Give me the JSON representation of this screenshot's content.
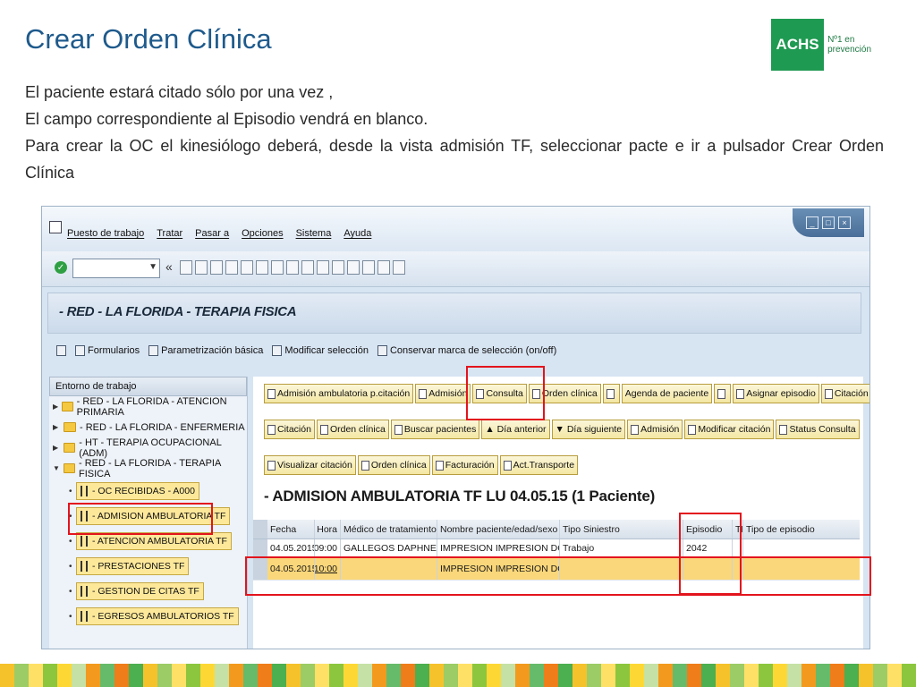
{
  "slide": {
    "title": "Crear Orden Clínica",
    "logo_text": "ACHS",
    "logo_tagline_1": "Nº1 en",
    "logo_tagline_2": "prevención",
    "para1": "El  paciente estará  citado sólo por una vez ,",
    "para2": "El campo correspondiente al  Episodio vendrá en blanco.",
    "para3": "Para crear la OC el kinesiólogo deberá, desde la vista admisión TF, seleccionar pacte e ir a pulsador Crear Orden Clínica"
  },
  "sap": {
    "menu": [
      "Puesto de trabajo",
      "Tratar",
      "Pasar a",
      "Opciones",
      "Sistema",
      "Ayuda"
    ],
    "toolbar": {
      "back_symbol": "«"
    },
    "title": "- RED - LA FLORIDA - TERAPIA FISICA",
    "app_toolbar": [
      "Formularios",
      "Parametrización básica",
      "Modificar selección",
      "Conservar marca de selección (on/off)"
    ],
    "left_panel": {
      "header": "Entorno de trabajo",
      "folders": [
        "- RED - LA FLORIDA - ATENCION PRIMARIA",
        "- RED - LA FLORIDA - ENFERMERIA",
        "- HT - TERAPIA OCUPACIONAL (ADM)",
        "- RED - LA FLORIDA - TERAPIA FISICA"
      ],
      "leaves": [
        "- OC RECIBIDAS - A000",
        "- ADMISION AMBULATORIA TF",
        "- ATENCION AMBULATORIA TF",
        "- PRESTACIONES TF",
        "- GESTION DE CITAS TF",
        "- EGRESOS AMBULATORIOS TF"
      ]
    },
    "buttons_row1": [
      "Admisión ambulatoria p.citación",
      "Admisión",
      "Consulta",
      "Orden clínica",
      "",
      "Agenda de paciente",
      "",
      "Asignar episodio",
      "Citación"
    ],
    "buttons_row2": [
      "Citación",
      "Orden clínica",
      "Buscar pacientes",
      "Día anterior",
      "Día siguiente",
      "Admisión",
      "Modificar citación",
      "Status Consulta"
    ],
    "buttons_row3": [
      "Visualizar citación",
      "Orden clínica",
      "Facturación",
      "Act.Transporte"
    ],
    "admission_title": "- ADMISION AMBULATORIA TF LU 04.05.15 (1  Paciente)",
    "grid": {
      "headers": [
        "Fecha",
        "Hora",
        "Médico de tratamiento",
        "Nombre paciente/edad/sexo",
        "Tipo Siniestro",
        "Episodio",
        "TE",
        "Tipo de episodio"
      ],
      "rows": [
        [
          "04.05.2015",
          "09:00",
          "GALLEGOS DAPHNE",
          "IMPRESION IMPRESION DOCTOS (",
          "Trabajo",
          "2042",
          "",
          ""
        ],
        [
          "04.05.2015",
          "10:00",
          "",
          "IMPRESION IMPRESION DOCTOS (...",
          "",
          "",
          "",
          ""
        ]
      ]
    }
  },
  "colors": {
    "title_blue": "#1e5a8c",
    "achs_green": "#1f9a52",
    "highlight_red": "#e3141d",
    "selected_row": "#fad77a"
  }
}
